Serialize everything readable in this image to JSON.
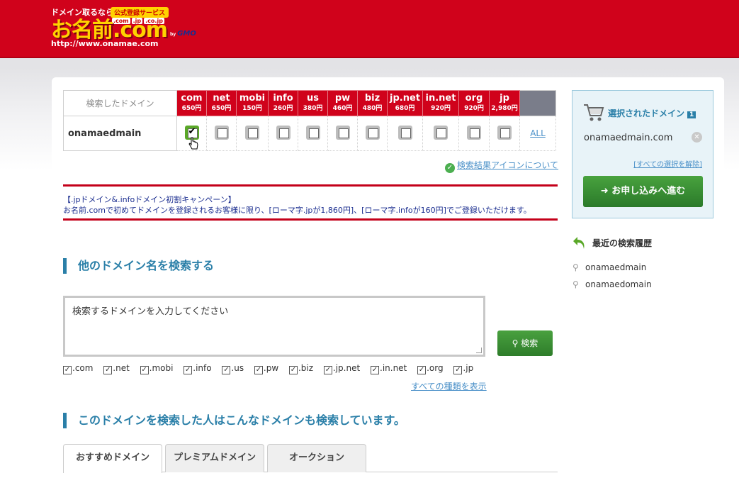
{
  "header": {
    "tagline": "ドメイン取るなら",
    "badge": "公式登録サービス",
    "tlds": [
      ".com",
      ".jp",
      ".co.jp"
    ],
    "logo": "お名前.com",
    "by": "by",
    "gmo": "GMO",
    "url": "http://www.onamae.com"
  },
  "domain_table": {
    "header_label": "検索したドメイン",
    "columns": [
      {
        "name": "com",
        "price": "650円"
      },
      {
        "name": "net",
        "price": "650円"
      },
      {
        "name": "mobi",
        "price": "150円"
      },
      {
        "name": "info",
        "price": "260円"
      },
      {
        "name": "us",
        "price": "380円"
      },
      {
        "name": "pw",
        "price": "460円"
      },
      {
        "name": "biz",
        "price": "480円"
      },
      {
        "name": "jp.net",
        "price": "680円"
      },
      {
        "name": "in.net",
        "price": "920円"
      },
      {
        "name": "org",
        "price": "920円"
      },
      {
        "name": "jp",
        "price": "2,980円"
      }
    ],
    "row_name": "onamaedmain",
    "checked": [
      true,
      false,
      false,
      false,
      false,
      false,
      false,
      false,
      false,
      false,
      false
    ],
    "all_link": "ALL"
  },
  "about_link": "検索結果アイコンについて",
  "campaign": {
    "line1": "【.jpドメイン&.infoドメイン初割キャンペーン】",
    "line2": "お名前.comで初めてドメインを登録されるお客様に限り、[ローマ字.jpが1,860円]、[ローマ字.infoが160円]でご登録いただけます。"
  },
  "search_section": {
    "title": "他のドメイン名を検索する",
    "placeholder": "検索するドメインを入力してください",
    "button": "検索",
    "tlds": [
      ".com",
      ".net",
      ".mobi",
      ".info",
      ".us",
      ".pw",
      ".biz",
      ".jp.net",
      ".in.net",
      ".org",
      ".jp"
    ],
    "show_all": "すべての種類を表示"
  },
  "related_section": {
    "title": "このドメインを検索した人はこんなドメインも検索しています。",
    "tabs": [
      "おすすめドメイン",
      "プレミアムドメイン",
      "オークション"
    ]
  },
  "cart": {
    "title": "選択されたドメイン",
    "count": "1",
    "domain": "onamaedmain.com",
    "clear_link": "[すべての選択を解除]",
    "order_button": "お申し込みへ進む"
  },
  "recent": {
    "title": "最近の検索履歴",
    "items": [
      "onamaedmain",
      "onamaedomain"
    ]
  },
  "colors": {
    "brand_red": "#d0021b",
    "accent_blue": "#2a7fa8",
    "button_green": "#3a8f34",
    "link_blue": "#4a90c8"
  }
}
